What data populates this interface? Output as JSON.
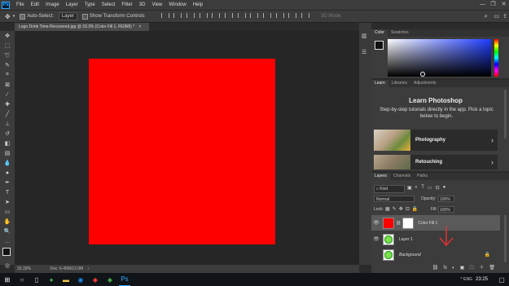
{
  "menubar": {
    "logo": "Ps",
    "items": [
      "File",
      "Edit",
      "Image",
      "Layer",
      "Type",
      "Select",
      "Filter",
      "3D",
      "View",
      "Window",
      "Help"
    ],
    "window_controls": [
      "—",
      "❐",
      "✕"
    ]
  },
  "optionsbar": {
    "auto_select_label": "Auto-Select:",
    "auto_select_value": "Layer",
    "show_transform_label": "Show Transform Controls",
    "mode_3d_label": "3D Mode:"
  },
  "document": {
    "tab_title": "Logo Drink Time-Recovered.jpg @ 33.3% (Color Fill 1, RGB/8) *",
    "tab_close": "×",
    "fill_color": "#ff0000"
  },
  "status": {
    "zoom": "33.33%",
    "doc_size": "Doc: 6.45M/12.0M",
    "arrow": "›"
  },
  "color_panel": {
    "tabs": [
      "Color",
      "Swatches"
    ]
  },
  "learn_panel": {
    "tabs": [
      "Learn",
      "Libraries",
      "Adjustments"
    ],
    "title": "Learn Photoshop",
    "subtitle": "Step-by-step tutorials directly in the app. Pick a topic below to begin.",
    "cards": [
      {
        "label": "Photography"
      },
      {
        "label": "Retouching"
      }
    ],
    "chevron": "›"
  },
  "layers_panel": {
    "tabs": [
      "Layers",
      "Channels",
      "Paths"
    ],
    "kind_label": "Kind",
    "blend_mode": "Normal",
    "opacity_label": "Opacity:",
    "opacity_value": "100%",
    "lock_label": "Lock:",
    "fill_label": "Fill:",
    "fill_value": "100%",
    "layers": [
      {
        "name": "Color Fill 1",
        "selected": true
      },
      {
        "name": "Layer 1",
        "selected": false
      },
      {
        "name": "Background",
        "selected": false
      }
    ],
    "footer_icons": [
      "⛓",
      "fx",
      "◐",
      "▣",
      "🗀",
      "＋",
      "🗑"
    ]
  },
  "annotation": {
    "arrow_color": "#e53030"
  },
  "taskbar": {
    "clock": "23:25",
    "tray": "^ ENG"
  }
}
